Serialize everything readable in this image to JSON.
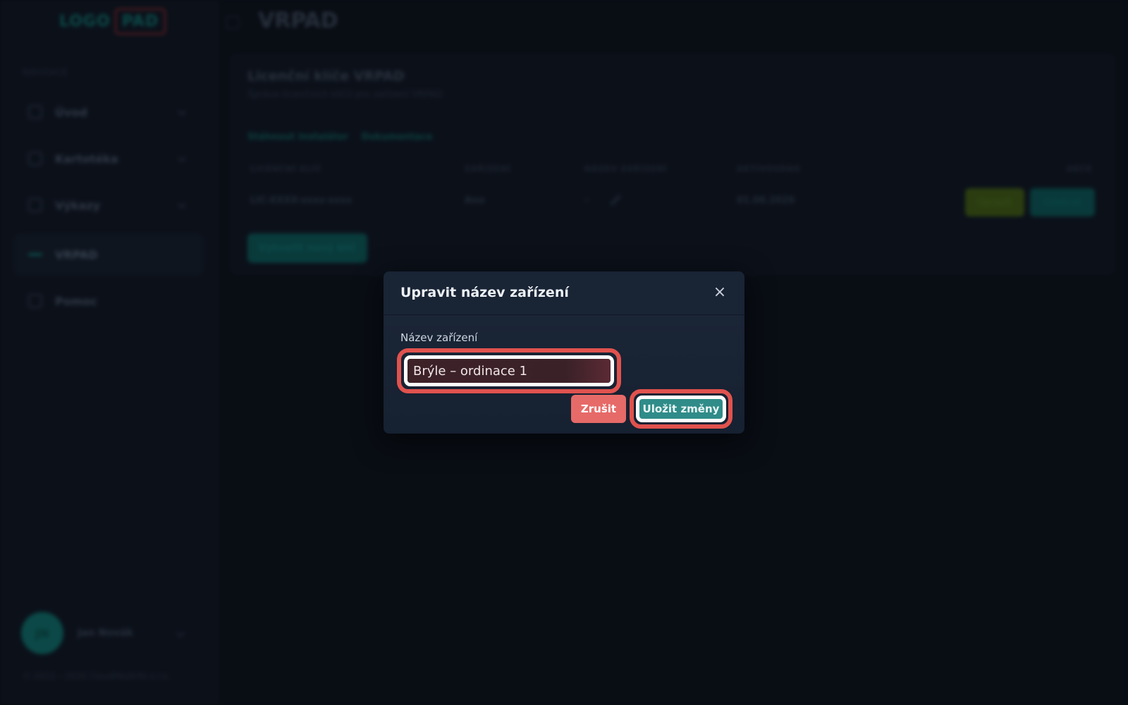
{
  "sidebar": {
    "logo_part1": "LOGO",
    "logo_part2": "PAD",
    "section_label": "NAVIGACE",
    "items": [
      {
        "label": "Úvod"
      },
      {
        "label": "Kartotéka"
      },
      {
        "label": "Výkazy"
      },
      {
        "label": "VRPAD"
      },
      {
        "label": "Pomoc"
      }
    ],
    "user": {
      "initials": "JN",
      "name": "Jan Novák"
    },
    "footer": "© 2022 – 2026 CloudMedInfo s.r.o."
  },
  "header": {
    "title": "VRPAD"
  },
  "card": {
    "title": "Licenční klíče VRPAD",
    "subtitle": "Správa licenčních klíčů pro zařízení VRPAD",
    "links": [
      "Stáhnout instalátor",
      "Dokumentace"
    ],
    "columns": [
      "LICENČNÍ KLÍČ",
      "ZAŘÍZENÍ",
      "NÁZEV ZAŘÍZENÍ",
      "AKTIVOVÁNO",
      "AKCE"
    ],
    "row": {
      "key": "LIC-XXXX-xxxx-xxxx",
      "device": "Ano",
      "name": "–",
      "activated": "01.06.2026",
      "btn_green": "Upravit",
      "btn_teal": "Odebrat"
    },
    "add_button": "Vytvořit nový klíč"
  },
  "modal": {
    "title": "Upravit název zařízení",
    "field_label": "Název zařízení",
    "device_name_value": "Brýle – ordinace 1",
    "cancel_label": "Zrušit",
    "save_label": "Uložit změny",
    "highlight_color": "#e0524e",
    "primary_color": "#2f8c89",
    "danger_color": "#e66a68"
  }
}
